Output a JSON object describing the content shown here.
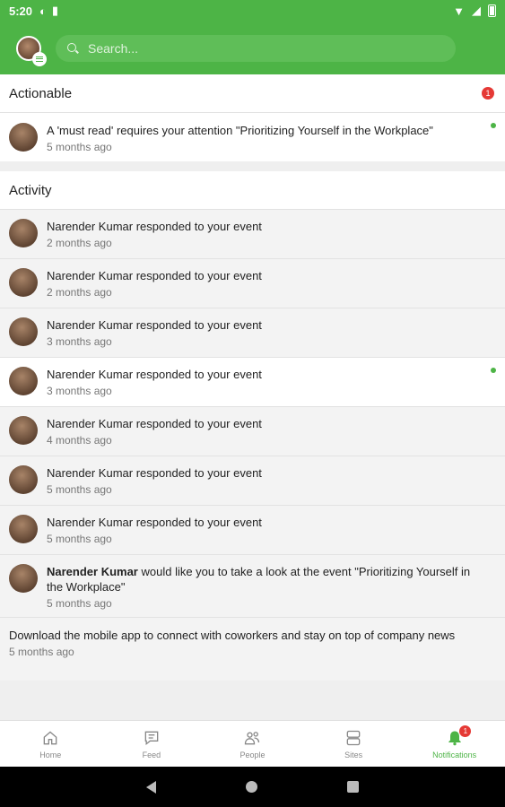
{
  "status_bar": {
    "time": "5:20"
  },
  "header": {
    "search_placeholder": "Search..."
  },
  "actionable": {
    "title": "Actionable",
    "badge_count": "1",
    "items": [
      {
        "text": "A 'must read' requires your attention \"Prioritizing Yourself in the Workplace\"",
        "time": "5 months ago"
      }
    ]
  },
  "activity": {
    "title": "Activity",
    "items": [
      {
        "text": "Narender Kumar responded to your event",
        "time": "2 months ago"
      },
      {
        "text": "Narender Kumar responded to your event",
        "time": "2 months ago"
      },
      {
        "text": "Narender Kumar responded to your event",
        "time": "3 months ago"
      },
      {
        "text": "Narender Kumar responded to your event",
        "time": "3 months ago"
      },
      {
        "text": "Narender Kumar responded to your event",
        "time": "4 months ago"
      },
      {
        "text": "Narender Kumar responded to your event",
        "time": "5 months ago"
      },
      {
        "text": "Narender Kumar responded to your event",
        "time": "5 months ago"
      },
      {
        "name": "Narender Kumar",
        "text": " would like you to take a look at the event \"Prioritizing Yourself in the Workplace\"",
        "time": "5 months ago"
      },
      {
        "text": "Download the mobile app to connect with coworkers and stay on top of company news",
        "time": "5 months ago"
      }
    ]
  },
  "bottom_nav": {
    "items": [
      {
        "label": "Home",
        "icon": "home-icon"
      },
      {
        "label": "Feed",
        "icon": "feed-icon"
      },
      {
        "label": "People",
        "icon": "people-icon"
      },
      {
        "label": "Sites",
        "icon": "sites-icon"
      },
      {
        "label": "Notifications",
        "icon": "bell-icon",
        "badge": "1"
      }
    ]
  },
  "colors": {
    "brand": "#4db446",
    "badge": "#e53935"
  }
}
